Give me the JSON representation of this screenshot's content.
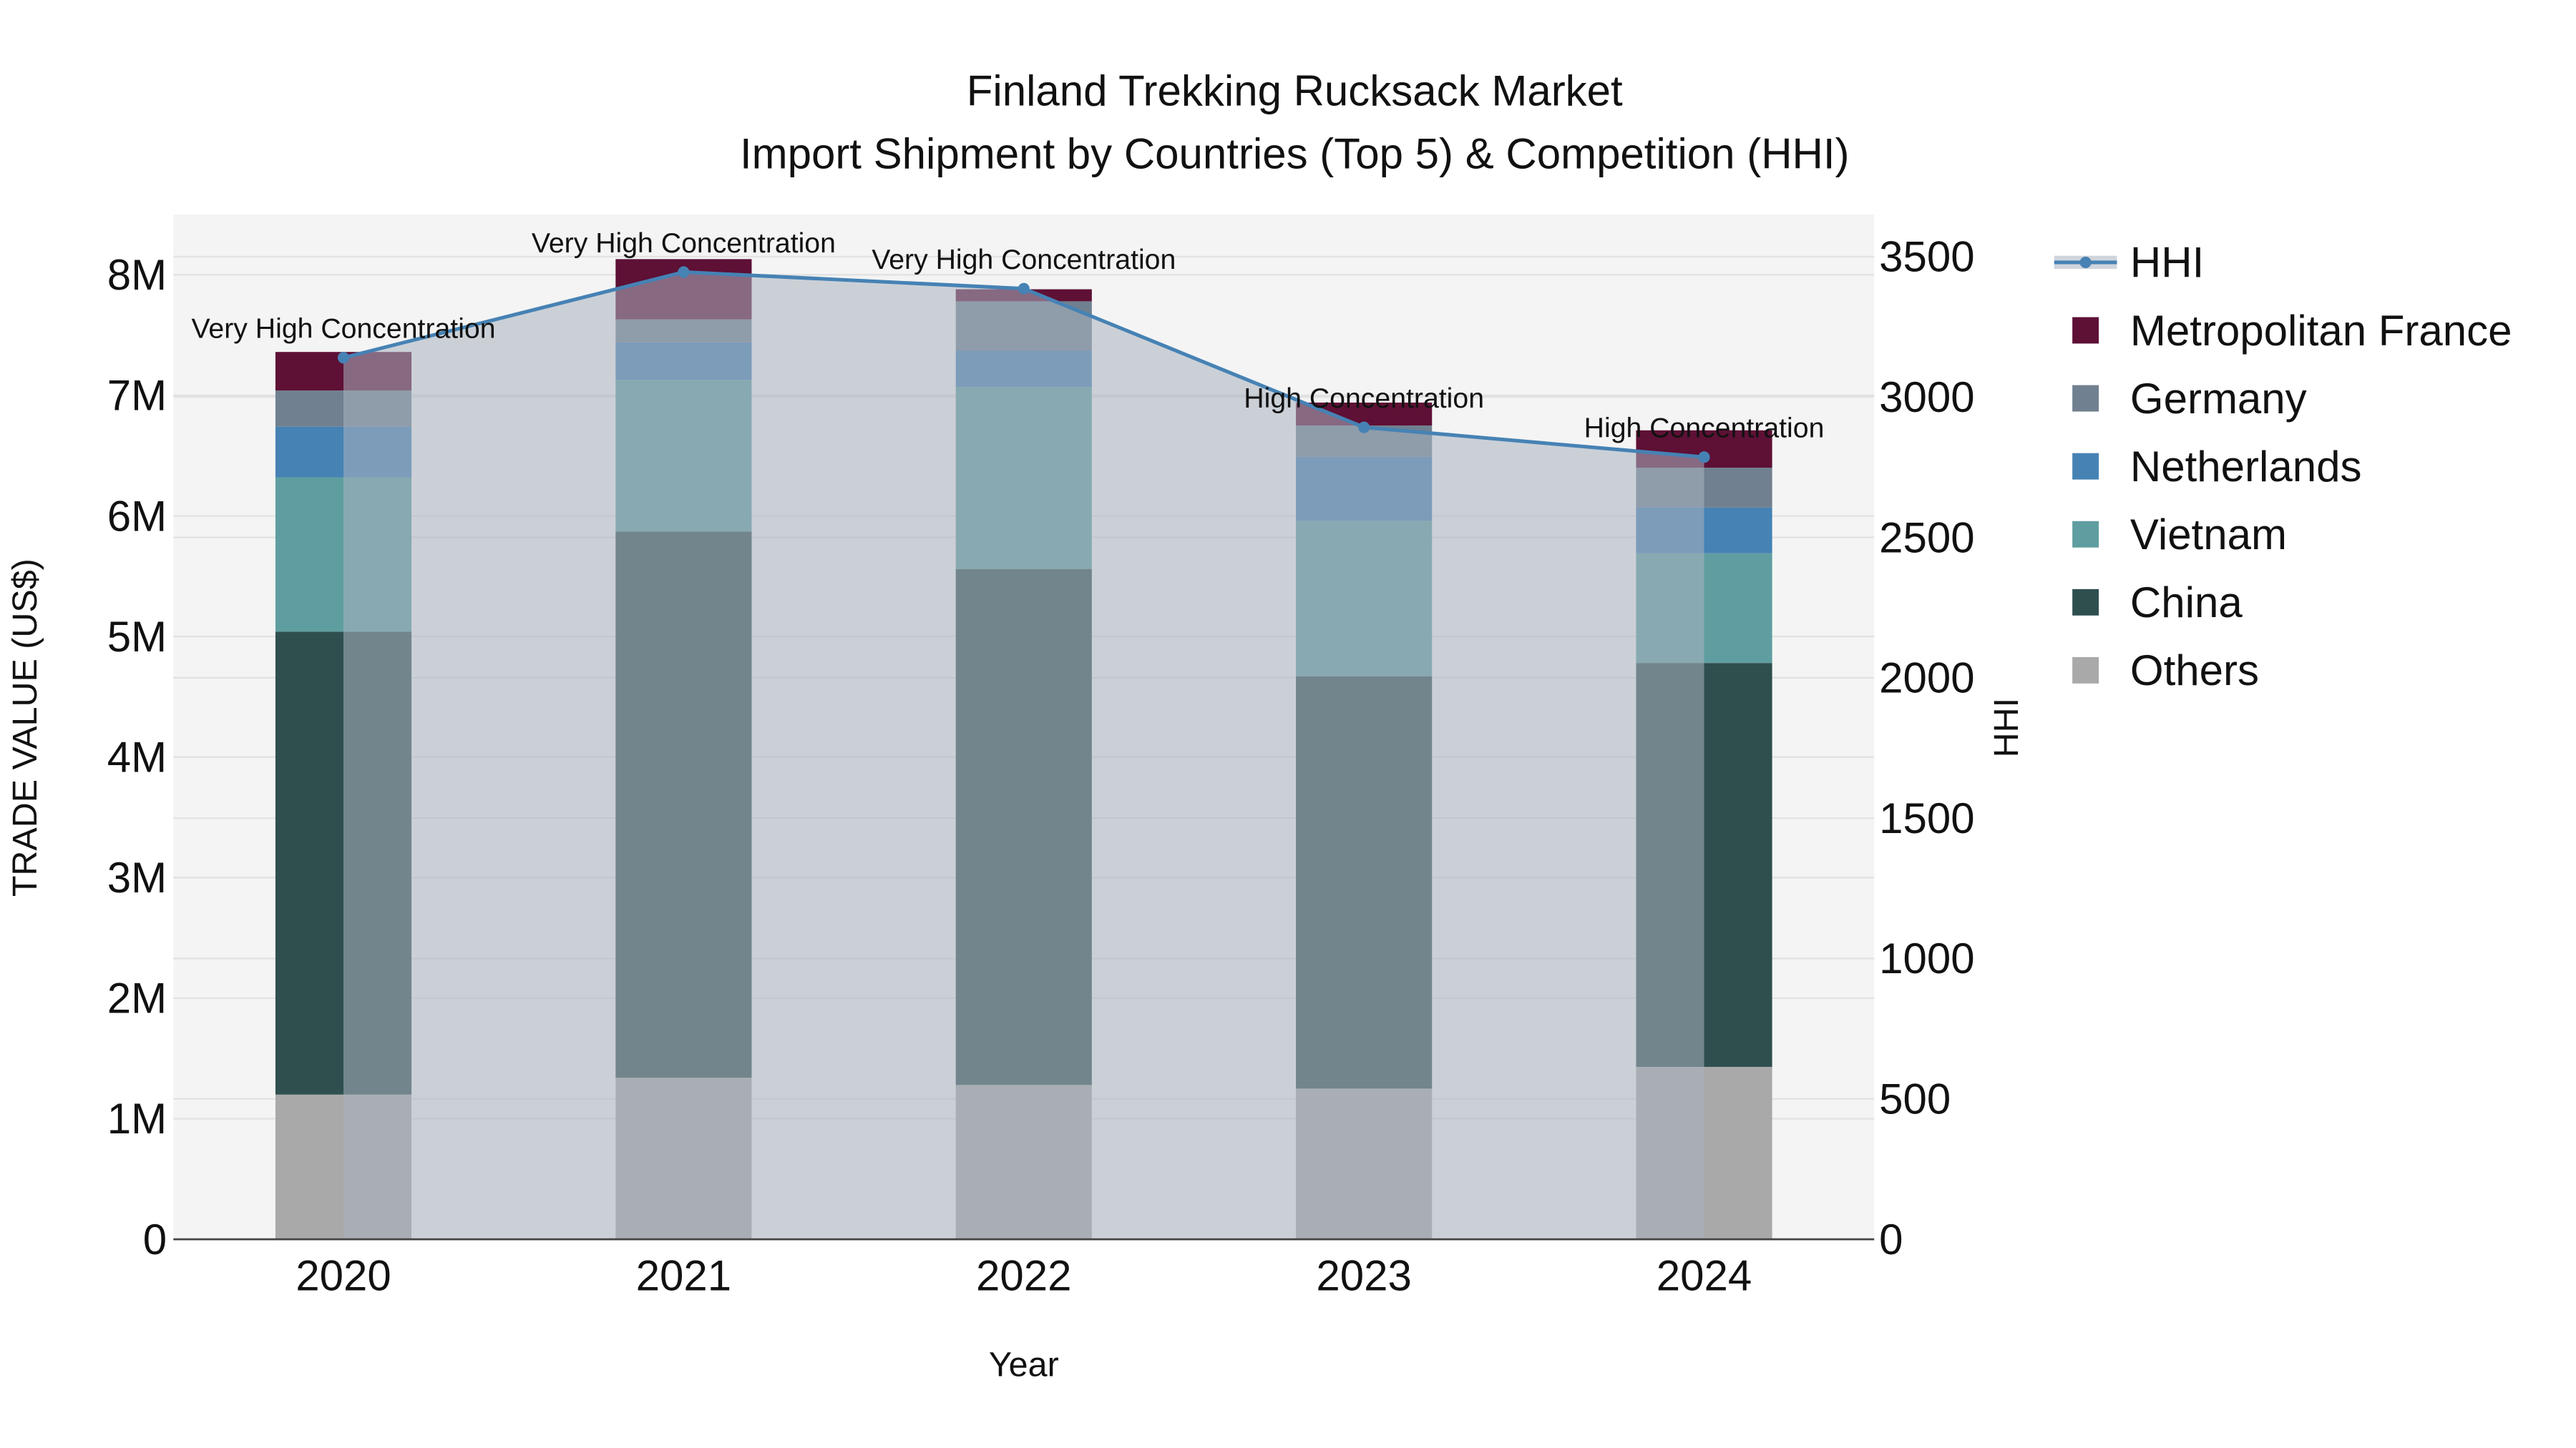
{
  "chart_data": {
    "type": "bar",
    "title": "Finland Trekking Rucksack Market",
    "subtitle": "Import Shipment by Countries (Top 5) & Competition (HHI)",
    "xlabel": "Year",
    "ylabel": "TRADE VALUE (US$)",
    "y2label": "HHI",
    "categories": [
      "2020",
      "2021",
      "2022",
      "2023",
      "2024"
    ],
    "ylim": [
      0,
      8500000
    ],
    "y2lim": [
      0,
      3650
    ],
    "yticks": [
      0,
      1000000,
      2000000,
      3000000,
      4000000,
      5000000,
      6000000,
      7000000,
      8000000
    ],
    "ytick_labels": [
      "0",
      "1M",
      "2M",
      "3M",
      "4M",
      "5M",
      "6M",
      "7M",
      "8M"
    ],
    "y2ticks": [
      0,
      500,
      1000,
      1500,
      2000,
      2500,
      3000,
      3500
    ],
    "y2tick_labels": [
      "0",
      "500",
      "1000",
      "1500",
      "2000",
      "2500",
      "3000",
      "3500"
    ],
    "barmode": "stack",
    "series": [
      {
        "name": "Others",
        "color": "#a9a9a9",
        "values": [
          1200000,
          1340000,
          1280000,
          1250000,
          1430000
        ]
      },
      {
        "name": "China",
        "color": "#2f4f4f",
        "values": [
          3840000,
          4530000,
          4280000,
          3420000,
          3350000
        ]
      },
      {
        "name": "Vietnam",
        "color": "#5f9ea0",
        "values": [
          1280000,
          1260000,
          1510000,
          1290000,
          910000
        ]
      },
      {
        "name": "Netherlands",
        "color": "#4682b4",
        "values": [
          420000,
          310000,
          300000,
          530000,
          380000
        ]
      },
      {
        "name": "Germany",
        "color": "#708090",
        "values": [
          300000,
          190000,
          410000,
          260000,
          330000
        ]
      },
      {
        "name": "Metropolitan France",
        "color": "#5e1035",
        "values": [
          320000,
          500000,
          100000,
          190000,
          310000
        ]
      }
    ],
    "line": {
      "name": "HHI",
      "color": "#4682b4",
      "values": [
        3140,
        3445,
        3386,
        2892,
        2786
      ],
      "annotations": [
        "Very High Concentration",
        "Very High Concentration",
        "Very High Concentration",
        "High Concentration",
        "High Concentration"
      ]
    },
    "legend": {
      "placement": "right",
      "order": [
        "HHI",
        "Metropolitan France",
        "Germany",
        "Netherlands",
        "Vietnam",
        "China",
        "Others"
      ]
    },
    "grid": true
  }
}
